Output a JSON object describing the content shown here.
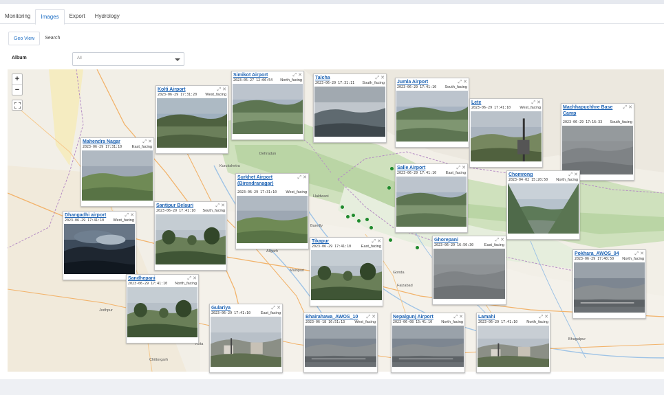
{
  "tabs": [
    "Monitoring",
    "Images",
    "Export",
    "Hydrology"
  ],
  "active_tab": "Images",
  "subtabs": [
    "Geo View",
    "Search"
  ],
  "active_subtab": "Geo View",
  "album": {
    "label": "Album",
    "value": "All"
  },
  "map": {
    "zoom_in": "+",
    "zoom_out": "−",
    "labels": {
      "dehradun": "Dehradun",
      "kurukshetra": "Kurukshetra",
      "bareilly": "Bareilly",
      "aligarh": "Aligarh",
      "jodhpur": "Jodhpur",
      "kota": "Kota",
      "chittorgarh": "Chittorgarh",
      "gonda": "Gonda",
      "bhagalpur": "Bhagalpur",
      "faizabad": "Faizabad",
      "haldwani": "Haldwani",
      "mainpuri": "Mainpuri"
    }
  },
  "cards": [
    {
      "title": "Kolti Airport",
      "datetime": "2023-06-29 17:31:20",
      "facing": "West_facing",
      "photo": "hills"
    },
    {
      "title": "Simikot Airport",
      "datetime": "2023-05-27 12:06:54",
      "facing": "North_facing",
      "photo": "valley"
    },
    {
      "title": "Talcha",
      "datetime": "2023-06-29 17:31:11",
      "facing": "South_facing",
      "photo": "dark-mountain"
    },
    {
      "title": "Jumla Airport",
      "datetime": "2023-06-29 17:41:10",
      "facing": "South_facing",
      "photo": "valley"
    },
    {
      "title": "Lete",
      "datetime": "2023-06-29 17:41:10",
      "facing": "West_facing",
      "photo": "tower"
    },
    {
      "title": "Machhapuchhre Base Camp",
      "datetime": "2023-06-29 17:16:33",
      "facing": "South_facing",
      "photo": "fog"
    },
    {
      "title": "Mahendra Nagar",
      "datetime": "2023-06-29 17:31:10",
      "facing": "East_facing",
      "photo": "field"
    },
    {
      "title": "Surkhet Airport (Birendranagar)",
      "datetime": "2023-06-29 17:31:10",
      "facing": "West_facing",
      "photo": "field"
    },
    {
      "title": "Salle Airport",
      "datetime": "2023-06-29 17:41:10",
      "facing": "East_facing",
      "photo": "valley"
    },
    {
      "title": "Chomrong",
      "datetime": "2023-04-02 15:20:50",
      "facing": "North_facing",
      "photo": "gorge"
    },
    {
      "title": "Santipur Belauri",
      "datetime": "2023-06-29 17:41:10",
      "facing": "South_facing",
      "photo": "trees"
    },
    {
      "title": "Dhangadhi airport",
      "datetime": "2023-06-29 17:41:10",
      "facing": "West_facing",
      "photo": "storm"
    },
    {
      "title": "Tikapur",
      "datetime": "2023-06-29 17:41:10",
      "facing": "East_facing",
      "photo": "trees"
    },
    {
      "title": "Ghorepani",
      "datetime": "2023-06-29 16:50:30",
      "facing": "East_facing",
      "photo": "fog"
    },
    {
      "title": "Pokhara_AWOS_04",
      "datetime": "2023-06-29 17:40:50",
      "facing": "North_facing",
      "photo": "runway"
    },
    {
      "title": "Sandhepani",
      "datetime": "2023-06-29 17:41:10",
      "facing": "North_facing",
      "photo": "trees"
    },
    {
      "title": "Gulariya",
      "datetime": "2023-06-29 17:41:10",
      "facing": "East_facing",
      "photo": "town"
    },
    {
      "title": "Bhairahawa_AWOS_10",
      "datetime": "2023-06-18 16:51:13",
      "facing": "West_facing",
      "photo": "runway"
    },
    {
      "title": "Nepalgunj Airport",
      "datetime": "2023-06-08 15:41:10",
      "facing": "North_facing",
      "photo": "runway"
    },
    {
      "title": "Lamahi",
      "datetime": "2023-06-29 17:41:10",
      "facing": "North_facing",
      "photo": "town"
    }
  ]
}
